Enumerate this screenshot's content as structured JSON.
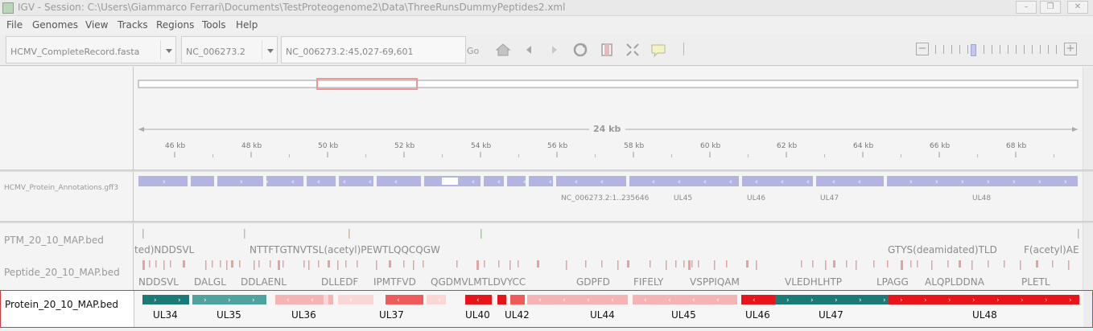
{
  "window": {
    "title": "IGV - Session: C:\\Users\\Giammarco Ferrari\\Documents\\TestProteogenome2\\Data\\ThreeRunsDummyPeptides2.xml",
    "buttons": [
      "–",
      "❐",
      "✕"
    ]
  },
  "menu": [
    "File",
    "Genomes",
    "View",
    "Tracks",
    "Regions",
    "Tools",
    "Help"
  ],
  "toolbar": {
    "genome": "HCMV_CompleteRecord.fasta",
    "chromosome": "NC_006273.2",
    "locus": "NC_006273.2:45,027-69,601",
    "go_label": "Go",
    "icons": [
      "home-icon",
      "back-icon",
      "forward-icon",
      "refresh-icon",
      "region-icon",
      "fit-icon",
      "popup-icon"
    ]
  },
  "ruler": {
    "span_label": "24 kb",
    "ticks": [
      "46 kb",
      "48 kb",
      "50 kb",
      "52 kb",
      "54 kb",
      "56 kb",
      "58 kb",
      "60 kb",
      "62 kb",
      "64 kb",
      "66 kb",
      "68 kb"
    ]
  },
  "tracks": {
    "annotations": {
      "name": "HCMV_Protein_Annotations.gff3",
      "labels": [
        "NC_006273.2:1..235646",
        "UL45",
        "UL46",
        "UL47",
        "UL48"
      ]
    },
    "ptm": {
      "name": "PTM_20_10_MAP.bed",
      "labels": [
        "ted)NDDSVL",
        "NTTFTGTNVTSL(acetyl)PEWTLQQCQGW",
        "GTYS(deamidated)TLD",
        "F(acetyl)AE"
      ]
    },
    "peptide": {
      "name": "Peptide_20_10_MAP.bed",
      "labels": [
        "NDDSVL",
        "DALGL",
        "DDLAENL",
        "DLLEDF",
        "IPMTFVD",
        "QGDMVLMTLDVYCC",
        "GDPFD",
        "FIFELY",
        "VSPPIQAM",
        "VLEDHLHTP",
        "LPAGG",
        "ALQPLDDNA",
        "PLETL"
      ]
    },
    "protein": {
      "name": "Protein_20_10_MAP.bed",
      "labels": [
        "UL34",
        "UL35",
        "UL36",
        "UL37",
        "UL40",
        "UL42",
        "UL44",
        "UL45",
        "UL46",
        "UL47",
        "UL48"
      ]
    }
  },
  "colors": {
    "teal": "#1a7a76",
    "teal_light": "#4ea39e",
    "red": "#e8141a",
    "red_mid": "#ef5a5a",
    "pink": "#f6b3b3",
    "pink_light": "#fbd6d6",
    "annotation_blue": "#b4b4e0"
  }
}
